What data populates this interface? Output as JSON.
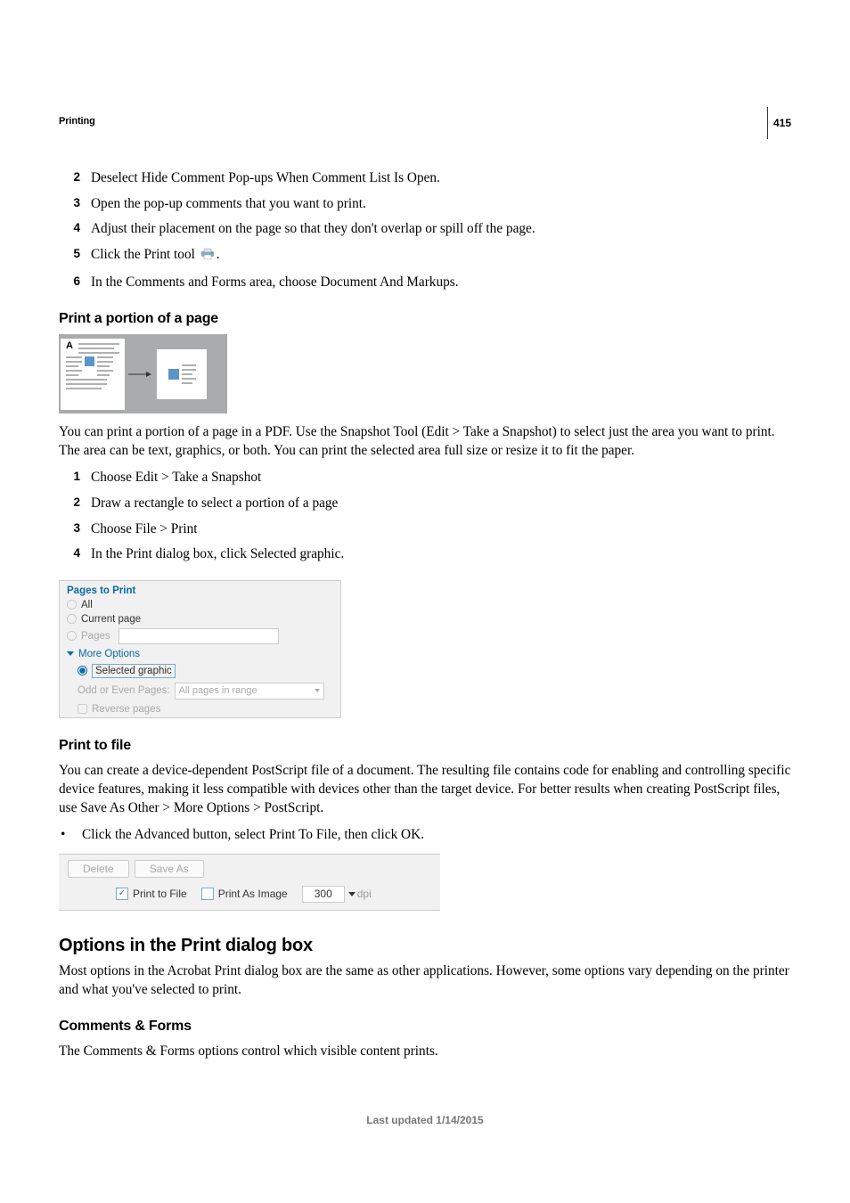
{
  "meta": {
    "chapter": "Printing",
    "page_number": "415",
    "footer": "Last updated 1/14/2015"
  },
  "steps_comments": [
    {
      "num": "2",
      "text": "Deselect Hide Comment Pop-ups When Comment List Is Open."
    },
    {
      "num": "3",
      "text": "Open the pop-up comments that you want to print."
    },
    {
      "num": "4",
      "text": "Adjust their placement on the page so that they don't overlap or spill off the page."
    },
    {
      "num": "5",
      "text": "Click the Print tool "
    },
    {
      "num": "6",
      "text": "In the Comments and Forms area, choose Document And Markups."
    }
  ],
  "step5_tail": ".",
  "sections": {
    "portion": {
      "heading": "Print a portion of a page",
      "body": "You can print a portion of a page in a PDF. Use the Snapshot Tool (Edit > Take a Snapshot) to select just the area you want to print. The area can be text, graphics, or both. You can print the selected area full size or resize it to fit the paper.",
      "steps": [
        {
          "num": "1",
          "text": "Choose Edit > Take a Snapshot"
        },
        {
          "num": "2",
          "text": "Draw a rectangle to select a portion of a page"
        },
        {
          "num": "3",
          "text": "Choose File > Print"
        },
        {
          "num": "4",
          "text": "In the Print dialog box, click Selected graphic."
        }
      ],
      "figure_label": "A"
    },
    "pages_panel": {
      "header": "Pages to Print",
      "all": "All",
      "current": "Current page",
      "pages": "Pages",
      "more_options": "More Options",
      "selected_graphic": "Selected graphic",
      "odd_even_label": "Odd or Even Pages:",
      "odd_even_value": "All pages in range",
      "reverse": "Reverse pages"
    },
    "print_to_file": {
      "heading": "Print to file",
      "body": "You can create a device-dependent PostScript file of a document. The resulting file contains code for enabling and controlling specific device features, making it less compatible with devices other than the target device. For better results when creating PostScript files, use Save As Other > More Options > PostScript.",
      "bullet": "Click the Advanced button, select Print To File, then click OK.",
      "bar": {
        "delete": "Delete",
        "save_as": "Save As",
        "print_to_file": "Print to File",
        "print_as_image": "Print As Image",
        "dpi_value": "300",
        "dpi_unit": "dpi"
      }
    },
    "options": {
      "heading": "Options in the Print dialog box",
      "body": "Most options in the Acrobat Print dialog box are the same as other applications. However, some options vary depending on the printer and what you've selected to print."
    },
    "comments_forms": {
      "heading": "Comments & Forms",
      "body": "The Comments & Forms options control which visible content prints."
    }
  }
}
